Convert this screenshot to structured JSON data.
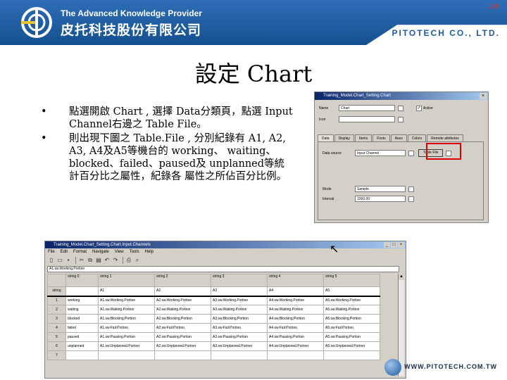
{
  "header": {
    "tagline": "The Advanced Knowledge Provider",
    "company_zh": "皮托科技股份有限公司",
    "company_en": "PITOTECH CO., LTD.",
    "page_number": "138"
  },
  "slide": {
    "title": "設定 Chart",
    "bullets": [
      "點選開啟 Chart , 選擇 Data分類頁，點選 Input Channel右邊之 Table File。",
      "則出現下圖之 Table.File , 分別紀錄有 A1, A2, A3, A4及A5等機台的 working、 waiting、blocked、failed、paused及 unplanned等統計百分比之屬性，紀錄各 屬性之所佔百分比例。"
    ]
  },
  "dialog": {
    "title": "Training_Model.Chart_Setting.Chart",
    "name_label": "Name",
    "name_value": "Chart",
    "icon_label": "Icon",
    "active_label": "Active",
    "tabs": [
      "Data",
      "Display",
      "Items",
      "Fonts",
      "Axes",
      "Colors",
      "Remote attributes"
    ],
    "data_source_label": "Data source",
    "data_source_value": "Input Channel",
    "table_file_button": "Table File",
    "mode_label": "Mode",
    "mode_value": "Sample",
    "interval_label": "Interval",
    "interval_value": "1000.00"
  },
  "table_window": {
    "title": "Training_Model.Chart_Setting.Chart.Input.Channels",
    "menu": [
      "File",
      "Edit",
      "Format",
      "Navigate",
      "View",
      "Tools",
      "Help"
    ],
    "cell_editor": "A1.sw.Working.Portion",
    "header_rows": [
      [
        "",
        "string 0",
        "string 1",
        "string 2",
        "string 3",
        "string 4",
        "string 5"
      ],
      [
        "string",
        "",
        "A1",
        "A2",
        "A3",
        "A4",
        "A5"
      ]
    ],
    "rows": [
      [
        "1",
        "working",
        "A1.sw.Working.Portion",
        "A2.sw.Working.Portion",
        "A3.sw.Working.Portion",
        "A4.sw.Working.Portion",
        "A5.sw.Working.Portion"
      ],
      [
        "2",
        "waiting",
        "A1.sw.Waiting.Portion",
        "A2.sw.Waiting.Portion",
        "A3.sw.Waiting.Portion",
        "A4.sw.Waiting.Portion",
        "A5.sw.Waiting.Portion"
      ],
      [
        "3",
        "blocked",
        "A1.sw.Blocking.Portion",
        "A2.sw.Blocking.Portion",
        "A3.sw.Blocking.Portion",
        "A4.sw.Blocking.Portion",
        "A5.sw.Blocking.Portion"
      ],
      [
        "4",
        "failed",
        "A1.sw.Fail.Portion",
        "A2.sw.Fail.Portion",
        "A3.sw.Fail.Portion",
        "A4.sw.Fail.Portion",
        "A5.sw.Fail.Portion"
      ],
      [
        "5",
        "paused",
        "A1.sw.Pausing.Portion",
        "A2.sw.Pausing.Portion",
        "A3.sw.Pausing.Portion",
        "A4.sw.Pausing.Portion",
        "A5.sw.Pausing.Portion"
      ],
      [
        "6",
        "unplanned",
        "A1.sw.Unplanned.Portion",
        "A2.sw.Unplanned.Portion",
        "A3.sw.Unplanned.Portion",
        "A4.sw.Unplanned.Portion",
        "A5.sw.Unplanned.Portion"
      ],
      [
        "7",
        "",
        "",
        "",
        "",
        "",
        ""
      ]
    ]
  },
  "footer": {
    "url": "WWW.PITOTECH.COM.TW"
  }
}
